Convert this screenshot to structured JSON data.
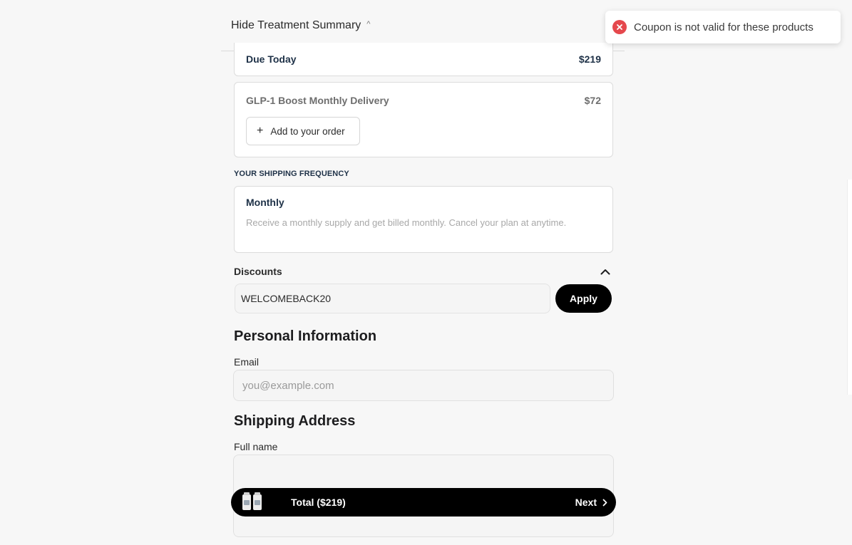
{
  "header": {
    "toggle_label": "Hide Treatment Summary",
    "caret": "^"
  },
  "summary": {
    "due_today_label": "Due Today",
    "due_today_value": "$219",
    "addon_name": "GLP-1 Boost Monthly Delivery",
    "addon_price": "$72",
    "add_button_label": "Add to your order",
    "add_button_glyph": "+"
  },
  "shipping_frequency": {
    "caption": "YOUR SHIPPING FREQUENCY",
    "title": "Monthly",
    "description": "Receive a monthly supply and get billed monthly. Cancel your plan at anytime."
  },
  "discounts": {
    "label": "Discounts",
    "coupon_value": "WELCOMEBACK20",
    "apply_label": "Apply"
  },
  "personal": {
    "heading": "Personal Information",
    "email_label": "Email",
    "email_placeholder": "you@example.com"
  },
  "shipping": {
    "heading": "Shipping Address",
    "full_name_label": "Full name"
  },
  "footer_bar": {
    "total_label": "Total ($219)",
    "next_label": "Next"
  },
  "toast": {
    "message": "Coupon is not valid for these products",
    "color": "#e5484d"
  },
  "icons": [
    "chevron-up-icon",
    "plus-icon",
    "error-icon",
    "chevron-right-icon",
    "product-bottles-icon"
  ]
}
